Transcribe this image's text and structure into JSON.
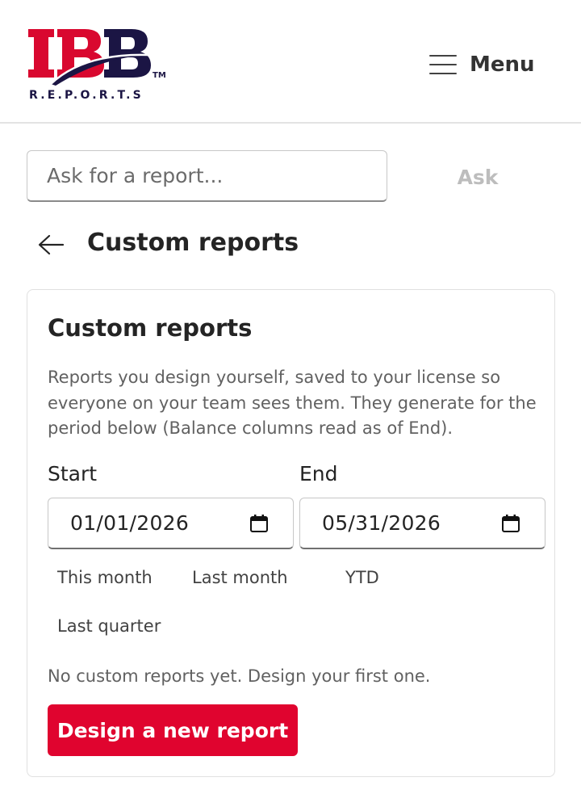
{
  "header": {
    "logo_text": "IBB",
    "logo_trademark": "TM",
    "logo_subtitle": "R.E.P.O.R.T.S",
    "menu_label": "Menu"
  },
  "ask": {
    "placeholder": "Ask for a report...",
    "button_label": "Ask"
  },
  "page": {
    "title": "Custom reports"
  },
  "card": {
    "title": "Custom reports",
    "description": "Reports you design yourself, saved to your license so everyone on your team sees them. They generate for the period below (Balance columns read as of End).",
    "start_label": "Start",
    "start_value": "01/01/2026",
    "end_label": "End",
    "end_value": "05/31/2026",
    "presets": [
      "This month",
      "Last month",
      "YTD",
      "Last quarter"
    ],
    "empty_message": "No custom reports yet. Design your first one.",
    "primary_button": "Design a new report"
  },
  "colors": {
    "brand_red": "#e0042f",
    "brand_navy": "#1b1544",
    "logo_red": "#d9082f"
  },
  "icons": [
    "menu-icon",
    "back-arrow-icon",
    "calendar-icon"
  ]
}
